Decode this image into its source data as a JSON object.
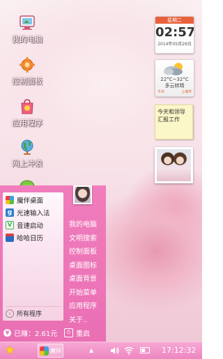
{
  "desktop": {
    "icons": [
      {
        "label": "我的电脑",
        "icon": "my-computer-icon"
      },
      {
        "label": "控制面板",
        "icon": "control-panel-icon"
      },
      {
        "label": "应用程序",
        "icon": "applications-icon"
      },
      {
        "label": "网上冲浪",
        "icon": "internet-globe-icon"
      }
    ]
  },
  "widgets": {
    "clock": {
      "weekday": "星期二",
      "time": "02:57",
      "date": "2014年05月26日"
    },
    "weather": {
      "temp": "22°C~32°C",
      "condition": "多云转晴",
      "left_label": "今日",
      "right_label": "上海市"
    },
    "note": {
      "text": "今天和领导汇报工作"
    }
  },
  "start_menu": {
    "left_items": [
      {
        "label": "魔伴桌面",
        "icon": "mobo-desktop-icon",
        "color": "#3aa0e8"
      },
      {
        "label": "光速输入法",
        "icon": "input-method-icon",
        "color": "#2f7fd0"
      },
      {
        "label": "音速启动",
        "icon": "quick-launch-icon",
        "color": "#3db050"
      },
      {
        "label": "哈哈日历",
        "icon": "calendar-icon",
        "color": "#2a6ac0"
      }
    ],
    "all_programs": "所有程序",
    "right_items": [
      "我的电脑",
      "文明搜索",
      "控制面板",
      "桌面图标",
      "桌面背景",
      "开始菜单",
      "应用程序",
      "关于.."
    ],
    "earn_label": "已赚：2.61元",
    "restart_label": "重启"
  },
  "taskbar": {
    "active_app_label": "魔伴",
    "clock": "17:12:32"
  }
}
